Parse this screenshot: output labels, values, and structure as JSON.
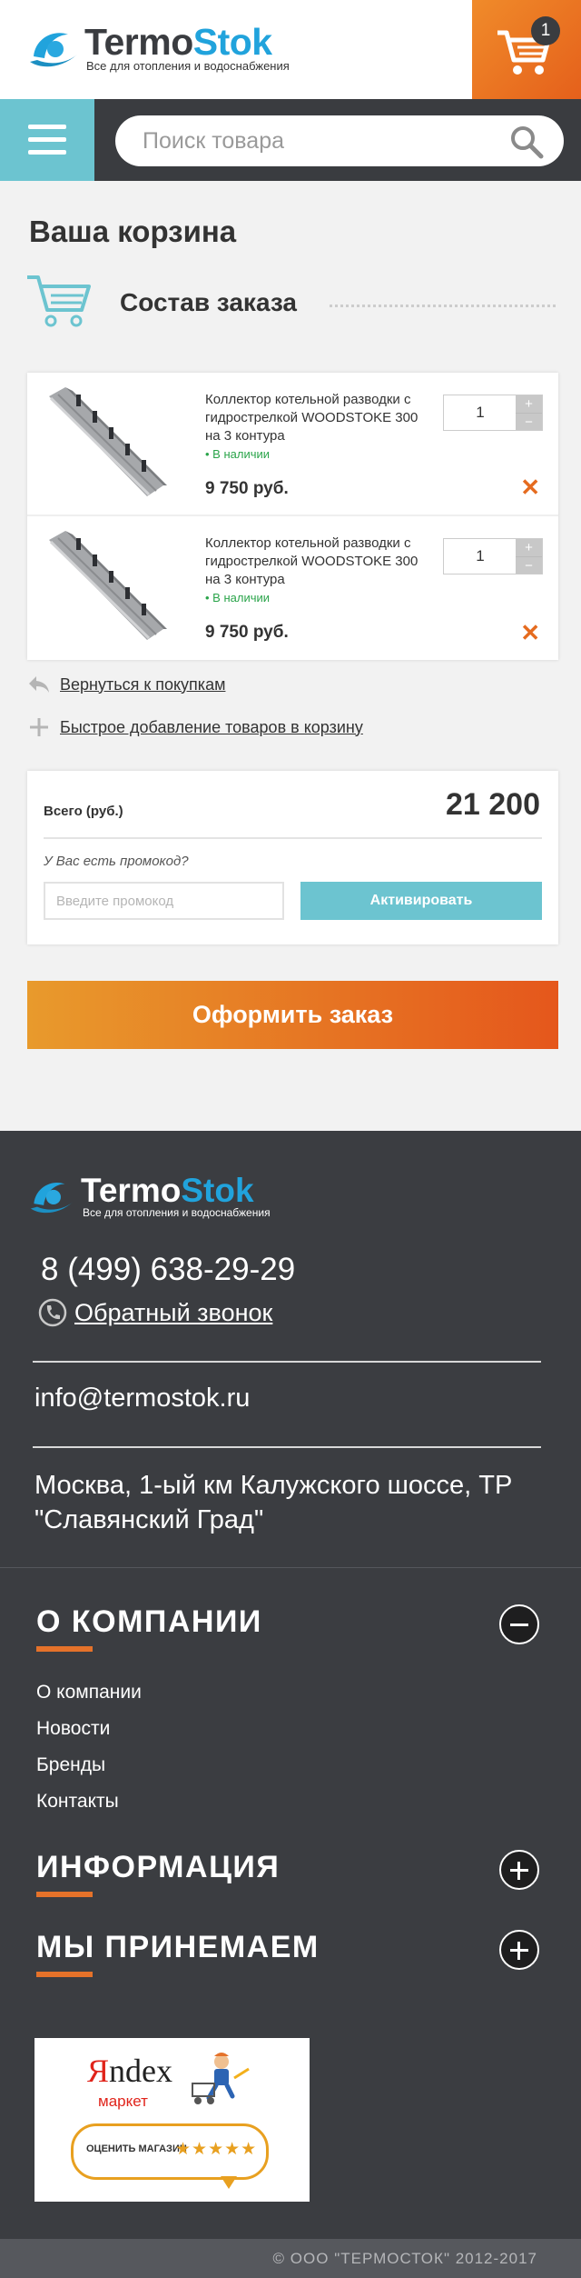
{
  "header": {
    "logo_part1": "Termo",
    "logo_part2": "Stok",
    "logo_tagline": "Все для отопления и водоснабжения",
    "cart_count": "1"
  },
  "search": {
    "placeholder": "Поиск товара"
  },
  "cart": {
    "title": "Ваша корзина",
    "section_title": "Состав заказа",
    "items": [
      {
        "name": "Коллектор котельной разводки с гидрострелкой WOODSTOKE 300 на 3 контура",
        "stock": "• В наличии",
        "price": "9 750 руб.",
        "qty": "1",
        "plus": "+",
        "minus": "−",
        "remove": "✕"
      },
      {
        "name": "Коллектор котельной разводки с гидрострелкой WOODSTOKE 300 на 3 контура",
        "stock": "• В наличии",
        "price": "9 750 руб.",
        "qty": "1",
        "plus": "+",
        "minus": "−",
        "remove": "✕"
      }
    ],
    "back_link": "Вернуться к покупкам",
    "quick_add_link": "Быстрое добавление товаров в корзину",
    "total_label": "Всего (руб.)",
    "total_value": "21 200",
    "promo_question": "У Вас есть промокод?",
    "promo_placeholder": "Введите промокод",
    "promo_button": "Активировать",
    "checkout_button": "Оформить заказ"
  },
  "footer": {
    "logo_part1": "Termo",
    "logo_part2": "Stok",
    "logo_tagline": "Все для отопления и водоснабжения",
    "phone": "8 (499) 638-29-29",
    "callback": "Обратный звонок",
    "email": "info@termostok.ru",
    "address": "Москва, 1-ый км Калужского шоссе, ТР \"Славянский Град\"",
    "sections": [
      {
        "title": "О КОМПАНИИ",
        "expanded": true,
        "links": [
          "О компании",
          "Новости",
          "Бренды",
          "Контакты"
        ]
      },
      {
        "title": "ИНФОРМАЦИЯ",
        "expanded": false
      },
      {
        "title": "МЫ ПРИНЕМАЕМ",
        "expanded": false
      }
    ],
    "banner": {
      "brand_y": "Я",
      "brand_rest": "ndex",
      "market": "маркет",
      "rate_text": "ОЦЕНИТЬ МАГАЗИН",
      "stars": "★★★★★"
    },
    "copyright": "© ООО \"ТЕРМОСТОК\" 2012-2017"
  },
  "colors": {
    "accent_orange": "#e5601b",
    "accent_teal": "#6cc4d0",
    "brand_blue": "#21a3dc",
    "footer_bg": "#3b3d41"
  }
}
